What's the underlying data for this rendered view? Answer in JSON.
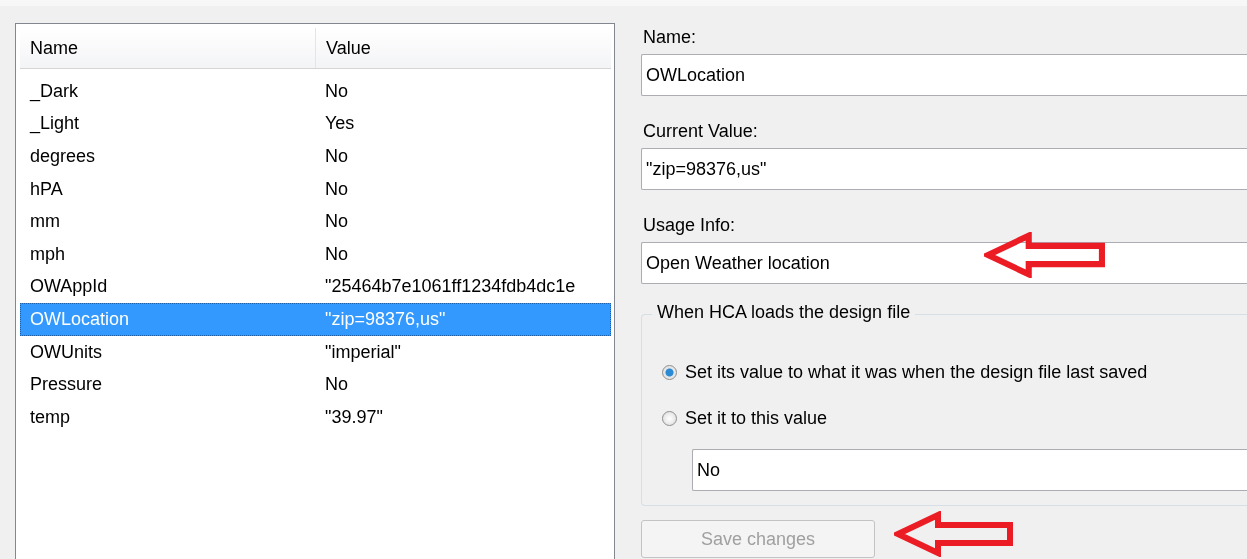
{
  "list": {
    "columns": [
      "Name",
      "Value"
    ],
    "rows": [
      {
        "name": "_Dark",
        "value": "No",
        "selected": false
      },
      {
        "name": "_Light",
        "value": "Yes",
        "selected": false
      },
      {
        "name": "degrees",
        "value": "No",
        "selected": false
      },
      {
        "name": "hPA",
        "value": "No",
        "selected": false
      },
      {
        "name": "mm",
        "value": "No",
        "selected": false
      },
      {
        "name": "mph",
        "value": "No",
        "selected": false
      },
      {
        "name": "OWAppId",
        "value": "\"25464b7e1061ff1234fdb4dc1e",
        "selected": false
      },
      {
        "name": "OWLocation",
        "value": "\"zip=98376,us\"",
        "selected": true
      },
      {
        "name": "OWUnits",
        "value": "\"imperial\"",
        "selected": false
      },
      {
        "name": "Pressure",
        "value": "No",
        "selected": false
      },
      {
        "name": "temp",
        "value": "\"39.97\"",
        "selected": false
      }
    ]
  },
  "fields": [
    {
      "label": "Name:",
      "value": "OWLocation"
    },
    {
      "label": "Current Value:",
      "value": "\"zip=98376,us\""
    },
    {
      "label": "Usage Info:",
      "value": "Open Weather location"
    }
  ],
  "load_group": {
    "title": "When HCA loads the design file",
    "options": [
      {
        "label": "Set its value to what it was when the design file last saved",
        "selected": true
      },
      {
        "label": "Set it to this value",
        "selected": false
      }
    ],
    "value": "No"
  },
  "save_button": {
    "label": "Save changes",
    "disabled": true
  }
}
